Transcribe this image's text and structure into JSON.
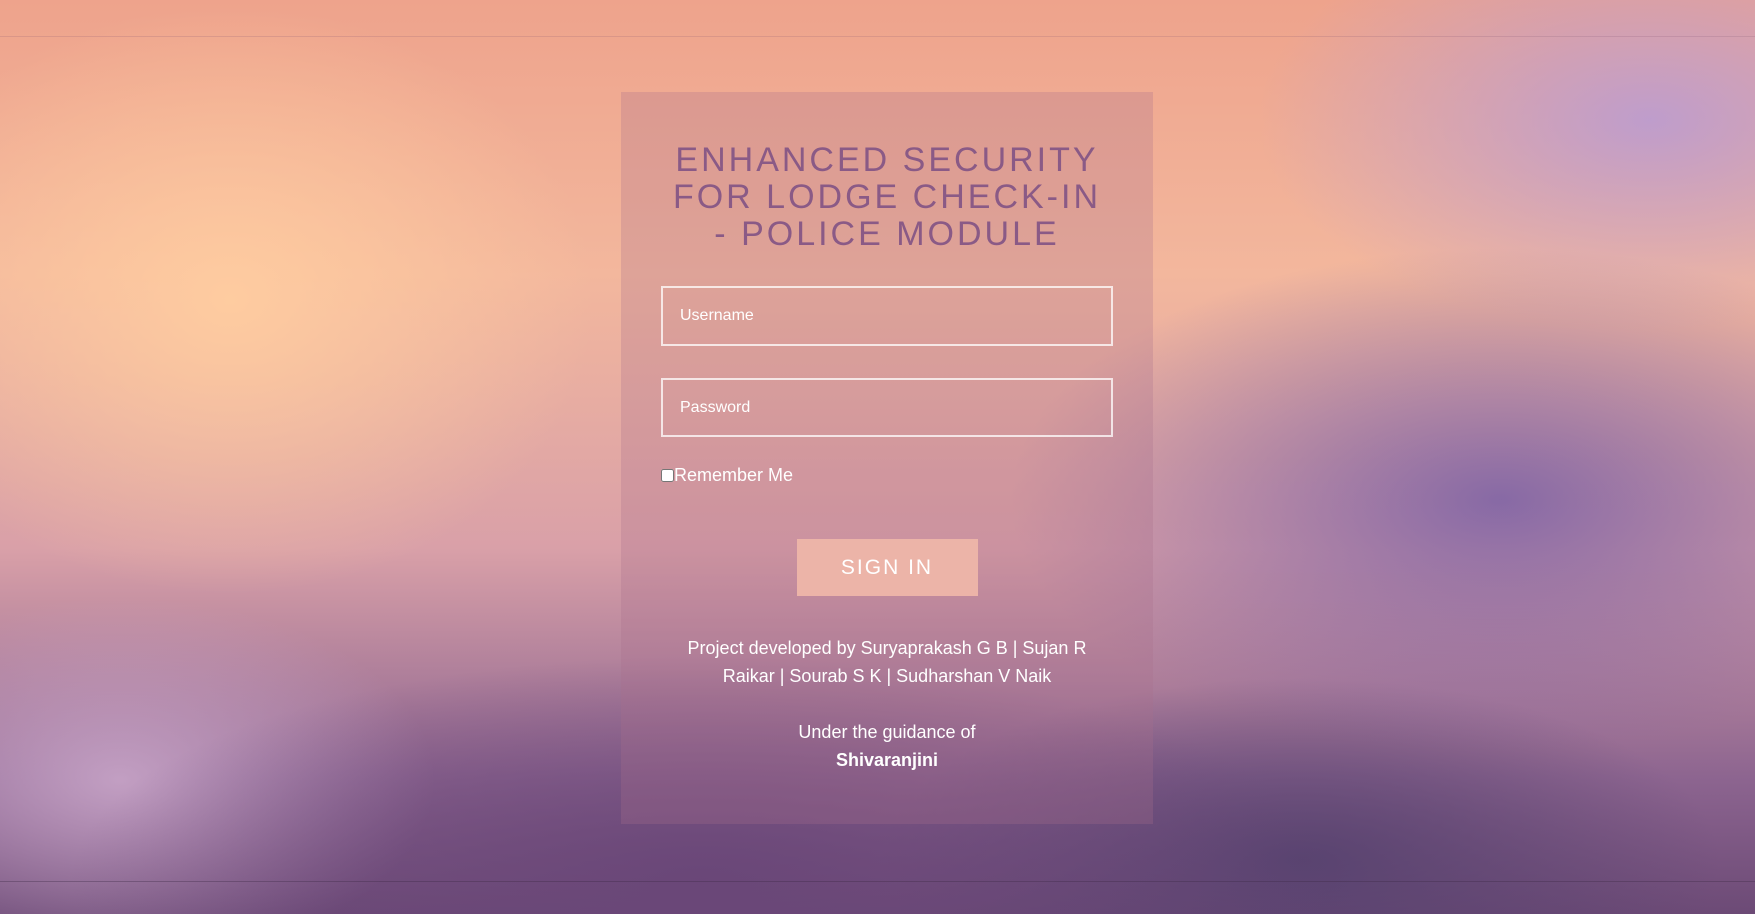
{
  "page": {
    "title": "ENHANCED SECURITY FOR LODGE CHECK-IN - POLICE MODULE"
  },
  "form": {
    "username_placeholder": "Username",
    "username_value": "",
    "password_placeholder": "Password",
    "password_value": "",
    "remember_label": "Remember Me",
    "remember_checked": false,
    "signin_label": "SIGN IN"
  },
  "footer": {
    "credits": "Project developed by Suryaprakash G B | Sujan R Raikar | Sourab S K | Sudharshan V Naik",
    "guidance_prefix": "Under the guidance of",
    "guide_name": "Shivaranjini"
  },
  "colors": {
    "title": "#8a5a86",
    "button_bg": "#ecb4a8",
    "text": "#ffffff"
  }
}
